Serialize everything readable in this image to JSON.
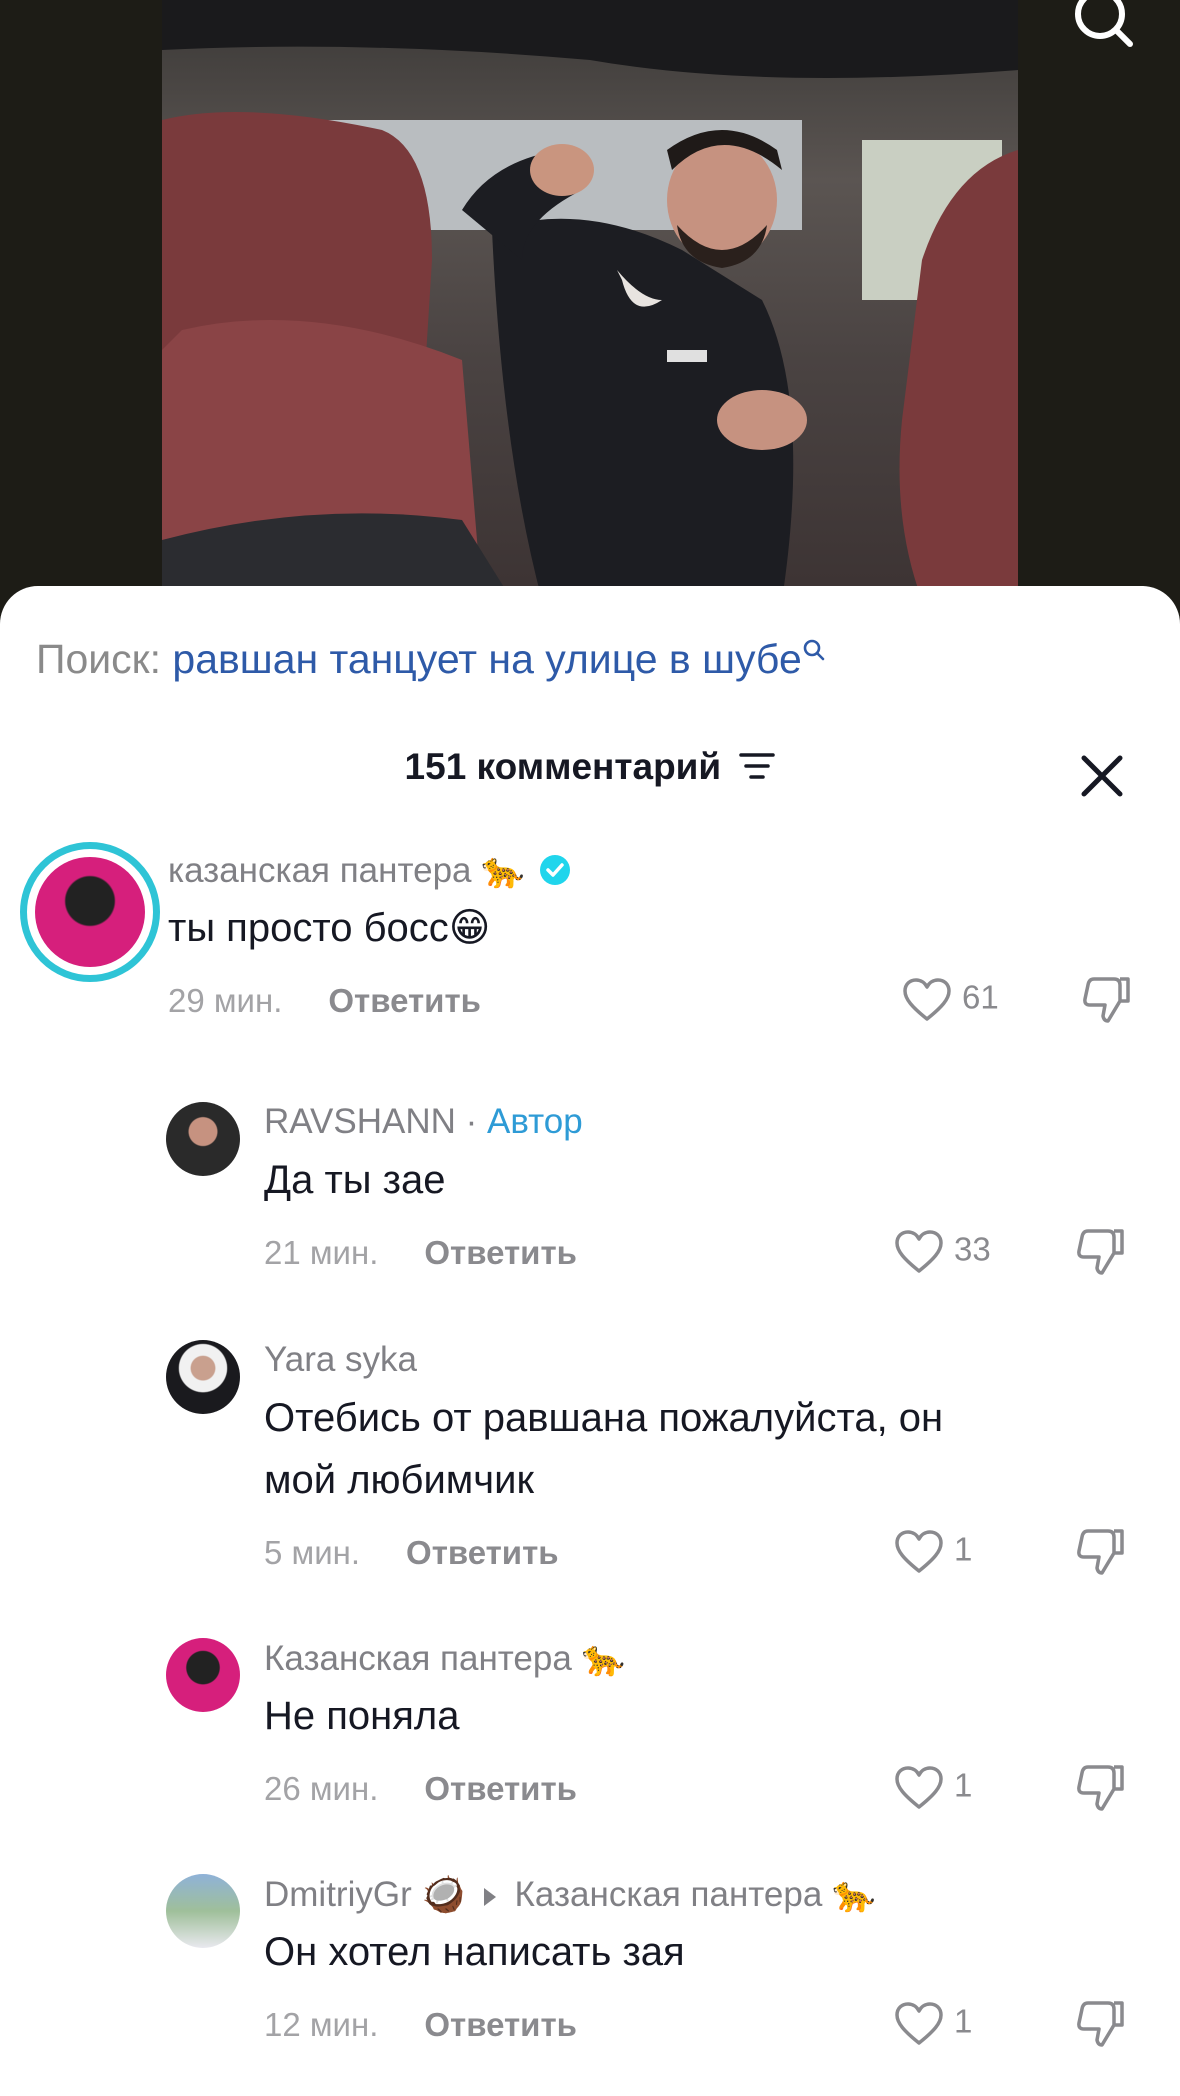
{
  "search": {
    "label": "Поиск:",
    "query": "равшан танцует на улице в шубе"
  },
  "comments_header": {
    "count_label": "151 комментарий"
  },
  "comments": [
    {
      "username": "казанская пантера 🐆",
      "verified": true,
      "text": "ты просто босс😁",
      "time": "29 мин.",
      "reply_label": "Ответить",
      "likes": "61"
    },
    {
      "username": "RAVSHANN",
      "author_sep": " · ",
      "author_tag": "Автор",
      "text": "Да ты зае",
      "time": "21 мин.",
      "reply_label": "Ответить",
      "likes": "33"
    },
    {
      "username": "Yara syka",
      "text_line1": "Отебись от равшана пожалуйста, он",
      "text_line2": "мой любимчик",
      "time": "5 мин.",
      "reply_label": "Ответить",
      "likes": "1"
    },
    {
      "username": "Казанская пантера 🐆",
      "text": "Не поняла",
      "time": "26 мин.",
      "reply_label": "Ответить",
      "likes": "1"
    },
    {
      "username": "DmitriyGr 🥥",
      "reply_to": "Казанская пантера 🐆",
      "text": "Он хотел написать зая",
      "time": "12 мин.",
      "reply_label": "Ответить",
      "likes": "1"
    }
  ],
  "icons": {
    "search": "search-icon",
    "sort": "sort-icon",
    "close": "close-icon",
    "like": "heart-icon",
    "dislike": "thumb-down-icon",
    "verified": "verified-badge-icon"
  },
  "colors": {
    "query_link": "#2e5aa8",
    "author_tag": "#2e9bd6",
    "verified": "#20d5ec",
    "story_ring": "#2ec4d6",
    "text": "#161823",
    "muted": "#808085"
  }
}
